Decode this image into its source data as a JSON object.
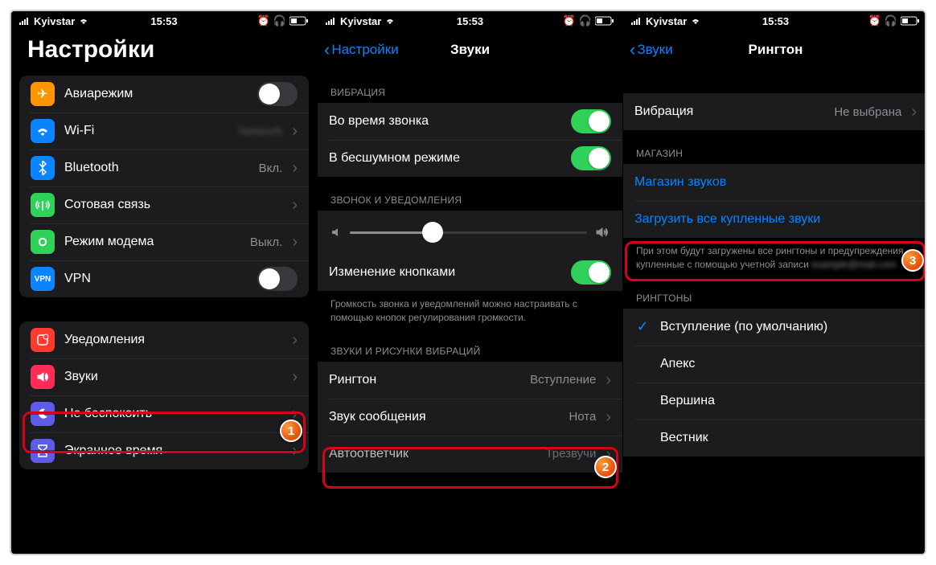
{
  "status": {
    "carrier": "Kyivstar",
    "time": "15:53"
  },
  "screen1": {
    "title": "Настройки",
    "items_top": [
      {
        "icon": "airplane",
        "color": "#ff9500",
        "label": "Авиарежим",
        "type": "toggle",
        "on": false
      },
      {
        "icon": "wifi",
        "color": "#0a84ff",
        "label": "Wi-Fi",
        "type": "link",
        "value": ""
      },
      {
        "icon": "bluetooth",
        "color": "#0a84ff",
        "label": "Bluetooth",
        "type": "link",
        "value": "Вкл."
      },
      {
        "icon": "antenna",
        "color": "#30d158",
        "label": "Сотовая связь",
        "type": "link",
        "value": ""
      },
      {
        "icon": "link",
        "color": "#30d158",
        "label": "Режим модема",
        "type": "link",
        "value": "Выкл."
      },
      {
        "icon": "vpn",
        "color": "#0a84ff",
        "label": "VPN",
        "type": "toggle",
        "on": false
      }
    ],
    "items_bottom": [
      {
        "icon": "bell",
        "color": "#ff3b30",
        "label": "Уведомления",
        "type": "link"
      },
      {
        "icon": "sound",
        "color": "#ff2d55",
        "label": "Звуки",
        "type": "link"
      },
      {
        "icon": "moon",
        "color": "#5e5ce6",
        "label": "Не беспокоить",
        "type": "link"
      },
      {
        "icon": "hourglass",
        "color": "#5e5ce6",
        "label": "Экранное время",
        "type": "link"
      }
    ]
  },
  "screen2": {
    "back": "Настройки",
    "title": "Звуки",
    "sec_vibration": "ВИБРАЦИЯ",
    "vib_ring": "Во время звонка",
    "vib_silent": "В бесшумном режиме",
    "sec_ringer": "ЗВОНОК И УВЕДОМЛЕНИЯ",
    "change_buttons": "Изменение кнопками",
    "ringer_footer": "Громкость звонка и уведомлений можно настраивать с помощью кнопок регулирования громкости.",
    "sec_sounds": "ЗВУКИ И РИСУНКИ ВИБРАЦИЙ",
    "ringtone_label": "Рингтон",
    "ringtone_value": "Вступление",
    "text_label": "Звук сообщения",
    "text_value": "Нота",
    "voicemail_label": "Автоответчик",
    "voicemail_value": "Трезвучи"
  },
  "screen3": {
    "back": "Звуки",
    "title": "Рингтон",
    "vibration_label": "Вибрация",
    "vibration_value": "Не выбрана",
    "sec_store": "МАГАЗИН",
    "store_link": "Магазин звуков",
    "download_link": "Загрузить все купленные звуки",
    "download_footer": "При этом будут загружены все рингтоны и предупреждения, купленные с помощью учетной записи",
    "sec_ringtones": "РИНГТОНЫ",
    "ringtones": [
      {
        "label": "Вступление (по умолчанию)",
        "selected": true
      },
      {
        "label": "Апекс",
        "selected": false
      },
      {
        "label": "Вершина",
        "selected": false
      },
      {
        "label": "Вестник",
        "selected": false
      }
    ]
  },
  "badges": {
    "one": "1",
    "two": "2",
    "three": "3"
  }
}
